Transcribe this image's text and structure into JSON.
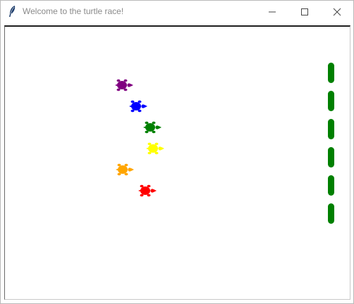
{
  "window": {
    "title": "Welcome to the turtle race!",
    "app_icon": "feather-icon",
    "controls": {
      "minimize_icon": "minimize-icon",
      "maximize_icon": "maximize-icon",
      "close_icon": "close-icon"
    }
  },
  "canvas": {
    "background": "#ffffff",
    "turtles": [
      {
        "name": "purple",
        "color": "#800080"
      },
      {
        "name": "blue",
        "color": "#0000ff"
      },
      {
        "name": "green",
        "color": "#008000"
      },
      {
        "name": "yellow",
        "color": "#ffff00"
      },
      {
        "name": "orange",
        "color": "#ffa500"
      },
      {
        "name": "red",
        "color": "#ff0000"
      }
    ],
    "finish_line": {
      "color": "#008000",
      "icon": "finish-line-dash"
    }
  }
}
